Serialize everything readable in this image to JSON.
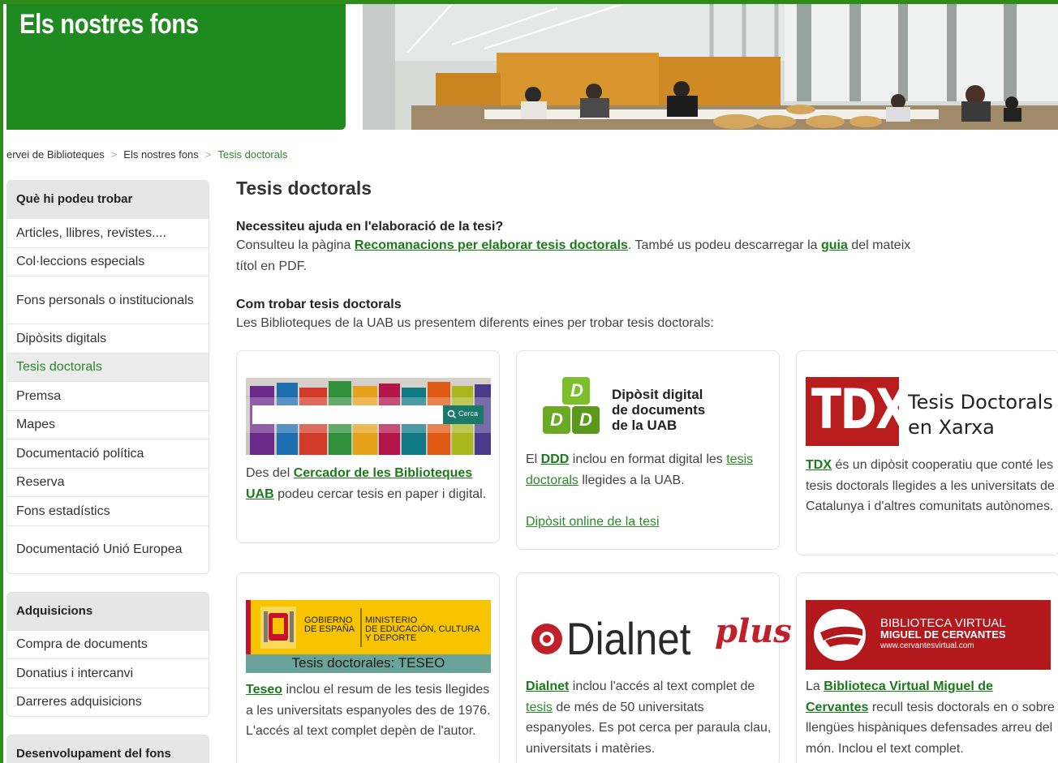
{
  "banner": {
    "title": "Els nostres fons"
  },
  "breadcrumb": {
    "items": [
      "ervei de Biblioteques",
      "Els nostres fons",
      "Tesis doctorals"
    ],
    "separator": ">"
  },
  "sidebar": {
    "section1": {
      "heading": "Què hi podeu trobar",
      "items": [
        "Articles, llibres, revistes....",
        "Col·leccions especials",
        "Fons personals o institucionals",
        "Dipòsits digitals",
        "Tesis doctorals",
        "Premsa",
        "Mapes",
        "Documentació política",
        "Reserva",
        "Fons estadístics",
        "Documentació Unió Europea"
      ]
    },
    "section2": {
      "heading": "Adquisicions",
      "items": [
        "Compra de documents",
        "Donatius i intercanvi",
        "Darreres adquisicions"
      ]
    },
    "section3": {
      "heading": "Desenvolupament del fons"
    }
  },
  "main": {
    "title": "Tesis doctorals",
    "help": {
      "heading": "Necessiteu ajuda en l'elaboració de la tesi?",
      "text1": "Consulteu la pàgina ",
      "link1": "Recomanacions per elaborar tesis doctorals",
      "text2": ". També us podeu descarregar la ",
      "link2": "guia",
      "text3": " del mateix títol en PDF."
    },
    "find": {
      "heading": "Com trobar tesis doctorals",
      "text": "Les Biblioteques de la UAB us presentem diferents eines per trobar tesis doctorals:"
    }
  },
  "cards": {
    "cercador": {
      "search_button": "Cerca",
      "text1": "Des del ",
      "link": "Cercador de les Biblioteques UAB",
      "text2": " podeu cercar tesis en paper i digital."
    },
    "ddd": {
      "logo_letters": "D",
      "logo_line1": "Dipòsit digital",
      "logo_line2": "de documents",
      "logo_line3": "de la UAB",
      "text1": "El ",
      "link1": "DDD",
      "text2": " inclou en format digital les ",
      "link2": "tesis doctorals",
      "text3": " llegides a la UAB.",
      "link3": "Dipòsit online de la tesi"
    },
    "tdx": {
      "logo_mark": "TDX",
      "logo_line1": "Tesis Doctorals",
      "logo_line2": "en Xarxa",
      "link": "TDX",
      "text": " és un dipòsit cooperatiu que conté les tesis doctorals llegides a les universitats de Catalunya i d'altres comunitats autònomes."
    },
    "teseo": {
      "gov1": "GOBIERNO",
      "gov2": "DE ESPAÑA",
      "min1": "MINISTERIO",
      "min2": "DE EDUCACIÓN, CULTURA",
      "min3": "Y DEPORTE",
      "caption": "Tesis doctorales: TESEO",
      "link": "Teseo",
      "text": " inclou el resum de les tesis llegides a les universitats espanyoles des de 1976. L'accés al text complet depèn de l'autor."
    },
    "dialnet": {
      "logo_word": "Dialnet",
      "logo_plus": "plus",
      "link1": "Dialnet",
      "text1": " inclou l'accés al text complet de ",
      "link2": "tesis",
      "text2": " de més de 50 universitats espanyoles. Es pot cerca per paraula clau, universitats i matèries."
    },
    "cervantes": {
      "logo_line1": "BIBLIOTECA VIRTUAL",
      "logo_line2": "MIGUEL DE CERVANTES",
      "logo_line3": "www.cervantesvirtual.com",
      "text1": "La ",
      "link": "Biblioteca Virtual Miguel de Cervantes",
      "text2": " recull tesis doctorals en o sobre llengües hispàniques defensades arreu del món. Inclou el text complet."
    }
  },
  "colors": {
    "brand_green": "#1f8a1f",
    "link_green": "#1a7a1a",
    "tdx_red": "#b81c1c",
    "cervantes_red": "#b3191c",
    "dialnet_red": "#c0202a",
    "spain_yellow": "#f8c400"
  }
}
